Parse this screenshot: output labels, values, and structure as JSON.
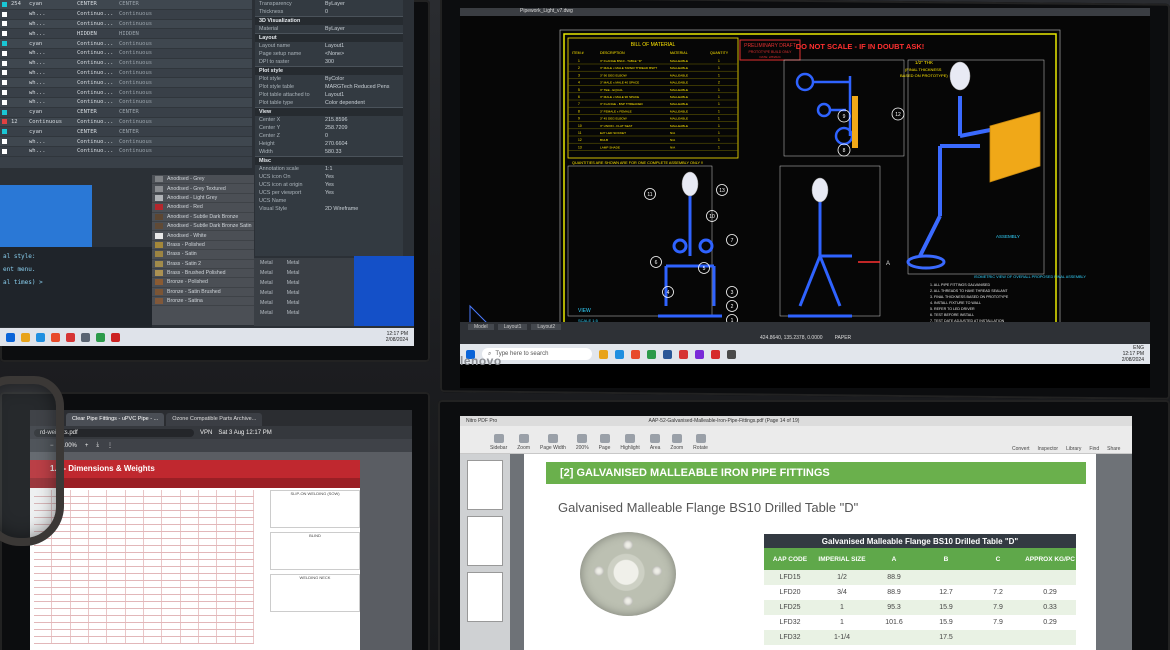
{
  "top_left": {
    "layers": [
      {
        "n": "254",
        "name": "cyan",
        "linetype": "CENTER",
        "ltype2": "CENTER",
        "color": "#19c6d4"
      },
      {
        "n": "",
        "name": "wh...",
        "linetype": "Continuo...",
        "ltype2": "Continuous",
        "color": "#ffffff"
      },
      {
        "n": "",
        "name": "wh...",
        "linetype": "Continuo...",
        "ltype2": "Continuous",
        "color": "#ffffff"
      },
      {
        "n": "",
        "name": "wh...",
        "linetype": "HIDDEN",
        "ltype2": "HIDDEN",
        "color": "#ffffff"
      },
      {
        "n": "",
        "name": "cyan",
        "linetype": "Continuo...",
        "ltype2": "Continuous",
        "color": "#19c6d4"
      },
      {
        "n": "",
        "name": "wh...",
        "linetype": "Continuo...",
        "ltype2": "Continuous",
        "color": "#ffffff"
      },
      {
        "n": "",
        "name": "wh...",
        "linetype": "Continuo...",
        "ltype2": "Continuous",
        "color": "#ffffff"
      },
      {
        "n": "",
        "name": "wh...",
        "linetype": "Continuo...",
        "ltype2": "Continuous",
        "color": "#ffffff"
      },
      {
        "n": "",
        "name": "wh...",
        "linetype": "Continuo...",
        "ltype2": "Continuous",
        "color": "#ffffff"
      },
      {
        "n": "",
        "name": "wh...",
        "linetype": "Continuo...",
        "ltype2": "Continuous",
        "color": "#ffffff"
      },
      {
        "n": "",
        "name": "wh...",
        "linetype": "Continuo...",
        "ltype2": "Continuous",
        "color": "#ffffff"
      },
      {
        "n": "",
        "name": "cyan",
        "linetype": "CENTER",
        "ltype2": "CENTER",
        "color": "#19c6d4"
      },
      {
        "n": "12",
        "name": "Continuous",
        "linetype": "Continuo...",
        "ltype2": "Continuous",
        "color": "#e04040"
      },
      {
        "n": "",
        "name": "cyan",
        "linetype": "CENTER",
        "ltype2": "CENTER",
        "color": "#19c6d4"
      },
      {
        "n": "",
        "name": "wh...",
        "linetype": "Continuo...",
        "ltype2": "Continuous",
        "color": "#ffffff"
      },
      {
        "n": "",
        "name": "wh...",
        "linetype": "Continuo...",
        "ltype2": "Continuous",
        "color": "#ffffff"
      }
    ],
    "props": {
      "top": [
        {
          "k": "Transparency",
          "v": "ByLayer"
        },
        {
          "k": "Thickness",
          "v": "0"
        }
      ],
      "sec_3d": "3D Visualization",
      "material": {
        "k": "Material",
        "v": "ByLayer"
      },
      "sec_layout": "Layout",
      "layout": [
        {
          "k": "Layout name",
          "v": "Layout1"
        },
        {
          "k": "Page setup name",
          "v": "<None>"
        },
        {
          "k": "DPI to raster",
          "v": "300"
        }
      ],
      "sec_plot": "Plot style",
      "plot": [
        {
          "k": "Plot style",
          "v": "ByColor"
        },
        {
          "k": "Plot style table",
          "v": "MARGTech Reduced Pens"
        },
        {
          "k": "Plot table attached to",
          "v": "Layout1"
        },
        {
          "k": "Plot table type",
          "v": "Color dependent"
        }
      ],
      "sec_view": "View",
      "view": [
        {
          "k": "Center X",
          "v": "215.8596"
        },
        {
          "k": "Center Y",
          "v": "258.7209"
        },
        {
          "k": "Center Z",
          "v": "0"
        },
        {
          "k": "Height",
          "v": "270.6604"
        },
        {
          "k": "Width",
          "v": "580.33"
        }
      ],
      "sec_misc": "Misc",
      "misc": [
        {
          "k": "Annotation scale",
          "v": "1:1"
        },
        {
          "k": "UCS icon On",
          "v": "Yes"
        },
        {
          "k": "UCS icon at origin",
          "v": "Yes"
        },
        {
          "k": "UCS per viewport",
          "v": "Yes"
        },
        {
          "k": "UCS Name",
          "v": ""
        },
        {
          "k": "Visual Style",
          "v": "2D Wireframe"
        }
      ]
    },
    "materials": [
      {
        "name": "Anodised - Grey",
        "color": "#7e8185"
      },
      {
        "name": "Anodised - Grey Textured",
        "color": "#8a8d91"
      },
      {
        "name": "Anodised - Light Grey",
        "color": "#b0b3b7"
      },
      {
        "name": "Anodised - Red",
        "color": "#b3262c"
      },
      {
        "name": "Anodised - Subtle Dark Bronze",
        "color": "#5c4632"
      },
      {
        "name": "Anodised - Subtle Dark Bronze Satin",
        "color": "#604a36"
      },
      {
        "name": "Anodised - White",
        "color": "#e8e8e8"
      },
      {
        "name": "Brass - Polished",
        "color": "#a3873a"
      },
      {
        "name": "Brass - Satin",
        "color": "#9c8442"
      },
      {
        "name": "Brass - Satin 2",
        "color": "#a18b4b"
      },
      {
        "name": "Brass - Brushed Polished",
        "color": "#ab9152"
      },
      {
        "name": "Bronze - Polished",
        "color": "#8a5b33"
      },
      {
        "name": "Bronze - Satin Brushed",
        "color": "#7b5535"
      },
      {
        "name": "Bronze - Satina",
        "color": "#80583a"
      }
    ],
    "mat_cols": [
      {
        "a": "Metal",
        "b": "Metal"
      },
      {
        "a": "Metal",
        "b": "Metal"
      },
      {
        "a": "Metal",
        "b": "Metal"
      },
      {
        "a": "Metal",
        "b": "Metal"
      },
      {
        "a": "Metal",
        "b": "Metal"
      },
      {
        "a": "Metal",
        "b": "Metal"
      }
    ],
    "editor_lines": [
      "al style:",
      "",
      "ent menu.",
      "",
      "al times) >"
    ],
    "clock": {
      "time": "12:17 PM",
      "date": "2/08/2024"
    }
  },
  "top_right": {
    "title": "Pipework_Light_v7.dwg",
    "bill_title": "BILL OF MATERIAL",
    "bill_headers": [
      "ITEM #",
      "DESCRIPTION",
      "MATERIAL",
      "QUANTITY"
    ],
    "bill_rows": [
      {
        "n": "1",
        "d": "3\" FLANGE BS10 - TABLE \"D\"",
        "m": "MALLEABLE",
        "q": "1"
      },
      {
        "n": "2",
        "d": "3\" MALE x MALE TAPER THREAD BSPT",
        "m": "MALLEABLE",
        "q": "1"
      },
      {
        "n": "3",
        "d": "3\" 90 DEG ELBOW",
        "m": "MALLEABLE",
        "q": "1"
      },
      {
        "n": "4",
        "d": "3\" MALE x MALE 40 SPACE",
        "m": "MALLEABLE",
        "q": "2"
      },
      {
        "n": "5",
        "d": "3\" TEE - EQUAL",
        "m": "MALLEABLE",
        "q": "1"
      },
      {
        "n": "6",
        "d": "3\" MALE x MALE 90 SPACE",
        "m": "MALLEABLE",
        "q": "1"
      },
      {
        "n": "7",
        "d": "3\" FLANGE - BSP THREADED",
        "m": "MALLEABLE",
        "q": "1"
      },
      {
        "n": "8",
        "d": "3\" FEMALE x FEMALE",
        "m": "MALLEABLE",
        "q": "1"
      },
      {
        "n": "9",
        "d": "3\" 45 DEG ELBOW",
        "m": "MALLEABLE",
        "q": "1"
      },
      {
        "n": "10",
        "d": "3\" UNION - FLAT SEAT",
        "m": "MALLEABLE",
        "q": "1"
      },
      {
        "n": "11",
        "d": "E27 LED SOCKET",
        "m": "N/A",
        "q": "1"
      },
      {
        "n": "12",
        "d": "BULB",
        "m": "N/A",
        "q": "1"
      },
      {
        "n": "13",
        "d": "LAMP SHADE",
        "m": "N/A",
        "q": "1"
      }
    ],
    "note_under_bill": "QUANTITIES ARE SHOWN ARE FOR ONE COMPLETE ASSEMBLY ONLY !!",
    "stamp": {
      "line1": "PRELIMINARY DRAFT",
      "line2": "PROTOTYPE BUILD ONLY",
      "line3": "DATE: 2/8/2024"
    },
    "warning": "DO NOT SCALE - IF IN DOUBT ASK!",
    "annot_top": "1/2\" THK",
    "annot_top2": "(FINAL THICKNESS",
    "annot_top3": "BASED ON PROTOTYPE)",
    "annot_iso": "ASSEMBLY",
    "iso_caption": "ISOMETRIC VIEW OF OVERALL PROPOSED FINAL ASSEMBLY",
    "view_label": "VIEW",
    "scale_label": "SCALE 1:5",
    "side_note": "ALL DIMENSIONS TO BE CONFIRMED",
    "arrow_label": "A",
    "notes": [
      "1. ALL PIPE FITTINGS GALVANISED",
      "2. ALL THREADS TO HAVE THREAD SEALANT",
      "3. FINAL THICKNESS BASED ON PROTOTYPE",
      "4. INSTALL FIXTURE TO WALL",
      "5. REFER TO LED DRIVER",
      "6. TEST BEFORE INSTALL",
      "7. TEST DATE ADJUSTED AT INSTALLATION"
    ],
    "balloons_front": [
      "11",
      "13",
      "10",
      "7",
      "6",
      "5",
      "4",
      "3",
      "2",
      "1"
    ],
    "balloons_top": [
      "9",
      "8",
      "12"
    ],
    "tabs": [
      "Model",
      "Layout1",
      "Layout2"
    ],
    "status_coords": "424.8640, 135.2378, 0.0000",
    "status_mode": "PAPER",
    "search_placeholder": "Type here to search",
    "tray_text": "ENG",
    "clock": {
      "time": "12:17 PM",
      "date": "2/08/2024"
    },
    "brand": "lenovo"
  },
  "bottom_left": {
    "tabs": [
      "Clear Pipe Fittings - uPVC Pipe - ...",
      "Ozone Compatible Parts Archive..."
    ],
    "url": "rd-weights.pdf",
    "zoom": "100%",
    "vpn": "VPN",
    "datetime": "Sat 3 Aug 12:17 PM",
    "pdf_heading": "- Dimensions & Weights",
    "pdf_code": "1.2",
    "diag_labels": [
      "SLIP-ON WELDING (SOW)",
      "BLIND",
      "WELDING NECK"
    ]
  },
  "bottom_right": {
    "app_title": "Nitro PDF Pro",
    "doc_title": "AAP-52-Galvanised-Malleable-Iron-Pipe-Fittings.pdf (Page 14 of 19)",
    "ribbon": [
      "Sidebar",
      "Zoom",
      "Page Width",
      "200%",
      "Page",
      "Highlight",
      "Area",
      "Zoom",
      "Rotate"
    ],
    "ribbon_right": [
      "Convert",
      "Inspector",
      "Library",
      "Find",
      "Share"
    ],
    "page_num": "14",
    "zoom_value": "200%",
    "section_heading": "[2] GALVANISED MALLEABLE IRON PIPE FITTINGS",
    "product_title": "Galvanised Malleable Flange BS10 Drilled Table \"D\"",
    "table_caption": "Galvanised Malleable Flange BS10 Drilled Table \"D\"",
    "table_headers": [
      "AAP CODE",
      "IMPERIAL SIZE",
      "A",
      "B",
      "C",
      "APPROX KG/PC"
    ],
    "table_rows": [
      [
        "LFD15",
        "1/2",
        "88.9",
        "",
        "",
        ""
      ],
      [
        "LFD20",
        "3/4",
        "88.9",
        "12.7",
        "7.2",
        "0.29"
      ],
      [
        "LFD25",
        "1",
        "95.3",
        "15.9",
        "7.9",
        "0.33"
      ],
      [
        "LFD32",
        "1",
        "101.6",
        "15.9",
        "7.9",
        "0.29"
      ],
      [
        "LFD32",
        "1-1/4",
        "",
        "17.5",
        "",
        ""
      ]
    ]
  }
}
